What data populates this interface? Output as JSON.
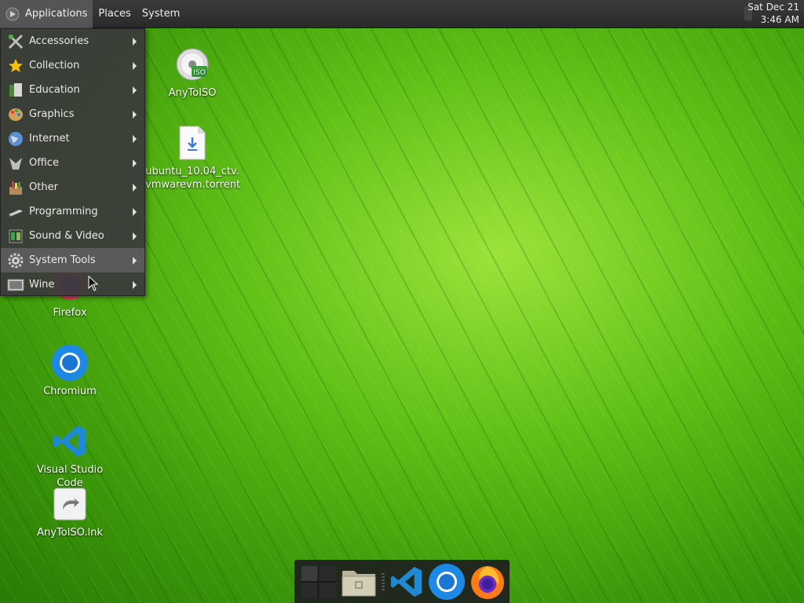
{
  "top_panel": {
    "menus": [
      "Applications",
      "Places",
      "System"
    ],
    "clock_date": "Sat Dec 21",
    "clock_time": "3:46 AM"
  },
  "app_menu": {
    "items": [
      {
        "label": "Accessories",
        "icon": "accessories-icon"
      },
      {
        "label": "Collection",
        "icon": "star-icon"
      },
      {
        "label": "Education",
        "icon": "education-icon"
      },
      {
        "label": "Graphics",
        "icon": "graphics-icon"
      },
      {
        "label": "Internet",
        "icon": "globe-icon"
      },
      {
        "label": "Office",
        "icon": "office-icon"
      },
      {
        "label": "Other",
        "icon": "other-icon"
      },
      {
        "label": "Programming",
        "icon": "programming-icon"
      },
      {
        "label": "Sound & Video",
        "icon": "media-icon"
      },
      {
        "label": "System Tools",
        "icon": "gear-icon"
      },
      {
        "label": "Wine",
        "icon": "wine-icon"
      }
    ],
    "highlighted": "System Tools"
  },
  "desktop": {
    "icons": [
      {
        "label": "AnyToISO",
        "icon": "anytoiso-disc-icon"
      },
      {
        "label": "ubuntu_10.04_ctv.\nvmwarevm.torrent",
        "label_line1": "ubuntu_10.04_ctv.",
        "label_line2": "vmwarevm.torrent",
        "icon": "torrent-file-icon"
      },
      {
        "label": "Firefox",
        "icon": "firefox-icon"
      },
      {
        "label": "Chromium",
        "icon": "chromium-icon"
      },
      {
        "label": "Visual Studio Code",
        "icon": "vscode-icon"
      },
      {
        "label": "AnyToISO.lnk",
        "icon": "shortcut-file-icon"
      }
    ]
  },
  "dock": {
    "items": [
      "workspace-switcher-icon",
      "file-manager-icon",
      "vscode-icon",
      "chromium-icon",
      "firefox-icon"
    ]
  },
  "colors": {
    "panel": "#2e2e2e",
    "menu_bg": "#3a3a3a",
    "highlight": "#5a5a5a",
    "wallpaper": "#5fbf16"
  }
}
